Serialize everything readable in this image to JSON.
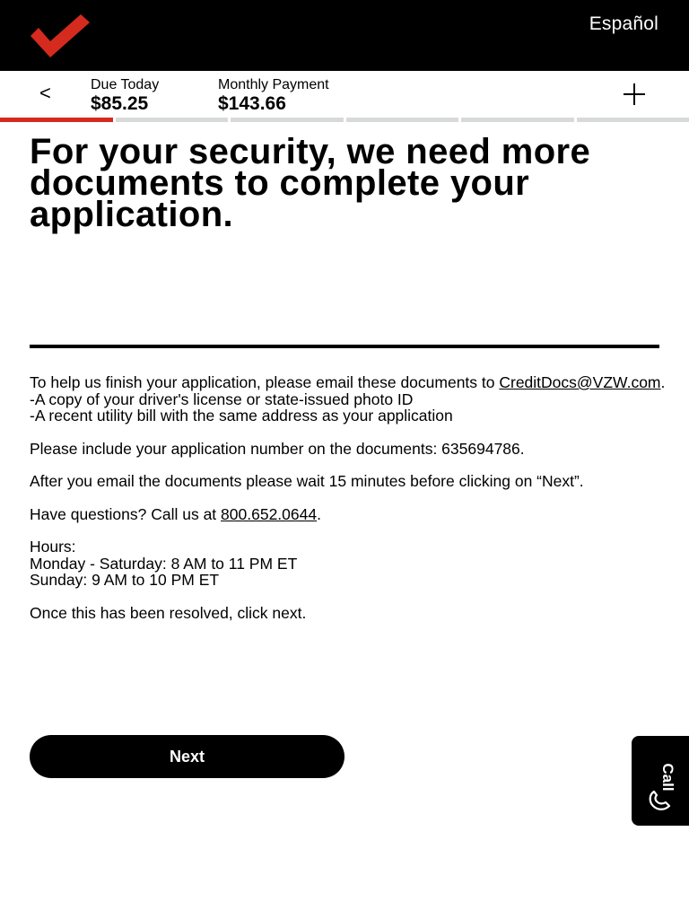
{
  "header": {
    "language_link": "Español",
    "brand_color": "#d52b1e"
  },
  "pricebar": {
    "back_symbol": "<",
    "due_today_label": "Due Today",
    "due_today_value": "$85.25",
    "monthly_label": "Monthly Payment",
    "monthly_value": "$143.66",
    "expand_icon": "plus-icon"
  },
  "progress": {
    "total_steps": 6,
    "active_steps": 1
  },
  "main": {
    "headline": "For your security, we need more documents to complete your application.",
    "intro_line1": "To help us finish your application, please email these documents to ",
    "email_link": "CreditDocs@VZW.com",
    "intro_period": ".",
    "doc_item1": "-A copy of your driver's license or state-issued photo ID",
    "doc_item2": "-A recent utility bill with the same address as your application",
    "app_number_text": "Please include your application number on the documents: 635694786.",
    "wait_text": "After you email the documents please wait 15 minutes before clicking on “Next”.",
    "questions_text": "Have questions? Call us at ",
    "phone_link": "800.652.0644",
    "questions_period": ".",
    "hours_label": "Hours:",
    "hours_weekday": "Monday - Saturday: 8 AM to 11 PM ET",
    "hours_sunday": "Sunday: 9 AM to 10 PM ET",
    "resolved_text": "Once this has been resolved, click next.",
    "next_button": "Next"
  },
  "call_tab": {
    "label": "Call",
    "icon": "phone-icon"
  }
}
